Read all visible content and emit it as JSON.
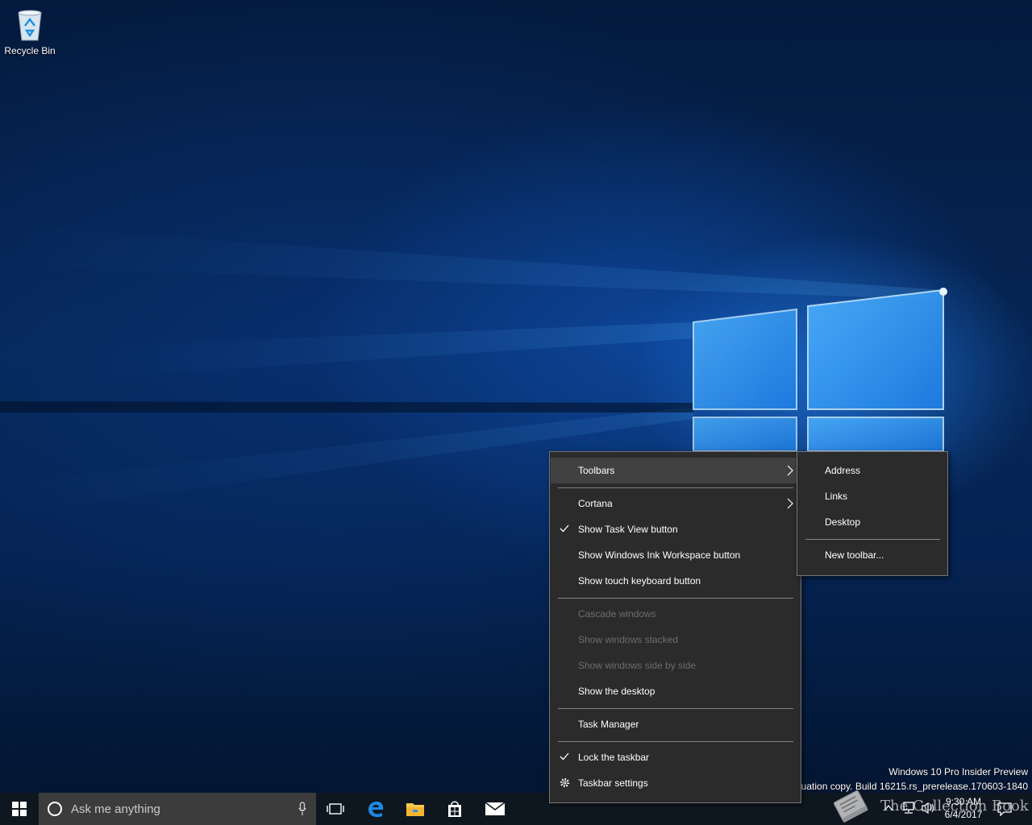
{
  "desktop": {
    "icons": [
      {
        "label": "Recycle Bin",
        "icon": "recycle-bin-icon"
      }
    ],
    "watermark": {
      "line1": "Windows 10 Pro Insider Preview",
      "line2": "Evaluation copy. Build 16215.rs_prerelease.170603-1840"
    }
  },
  "context_menu": {
    "items": [
      {
        "label": "Toolbars",
        "submenu": true,
        "highlighted": true
      },
      {
        "label": "Cortana",
        "submenu": true
      },
      {
        "label": "Show Task View button",
        "checked": true
      },
      {
        "label": "Show Windows Ink Workspace button"
      },
      {
        "label": "Show touch keyboard button"
      },
      {
        "label": "Cascade windows",
        "disabled": true
      },
      {
        "label": "Show windows stacked",
        "disabled": true
      },
      {
        "label": "Show windows side by side",
        "disabled": true
      },
      {
        "label": "Show the desktop"
      },
      {
        "label": "Task Manager"
      },
      {
        "label": "Lock the taskbar",
        "checked": true
      },
      {
        "label": "Taskbar settings",
        "icon": "gear-icon"
      }
    ]
  },
  "toolbars_submenu": {
    "items": [
      {
        "label": "Address"
      },
      {
        "label": "Links"
      },
      {
        "label": "Desktop"
      },
      {
        "label": "New toolbar..."
      }
    ]
  },
  "taskbar": {
    "search_placeholder": "Ask me anything",
    "pinned": [
      "start-icon",
      "task-view-icon",
      "edge-icon",
      "file-explorer-icon",
      "store-icon",
      "mail-icon"
    ],
    "clock": {
      "time": "9:30 AM",
      "date": "6/4/2017"
    },
    "tray": [
      "chevron-up-icon",
      "network-icon",
      "volume-icon",
      "notification-icon"
    ],
    "overlay_logo": "The Collection Book",
    "accent": "#0078d7"
  }
}
